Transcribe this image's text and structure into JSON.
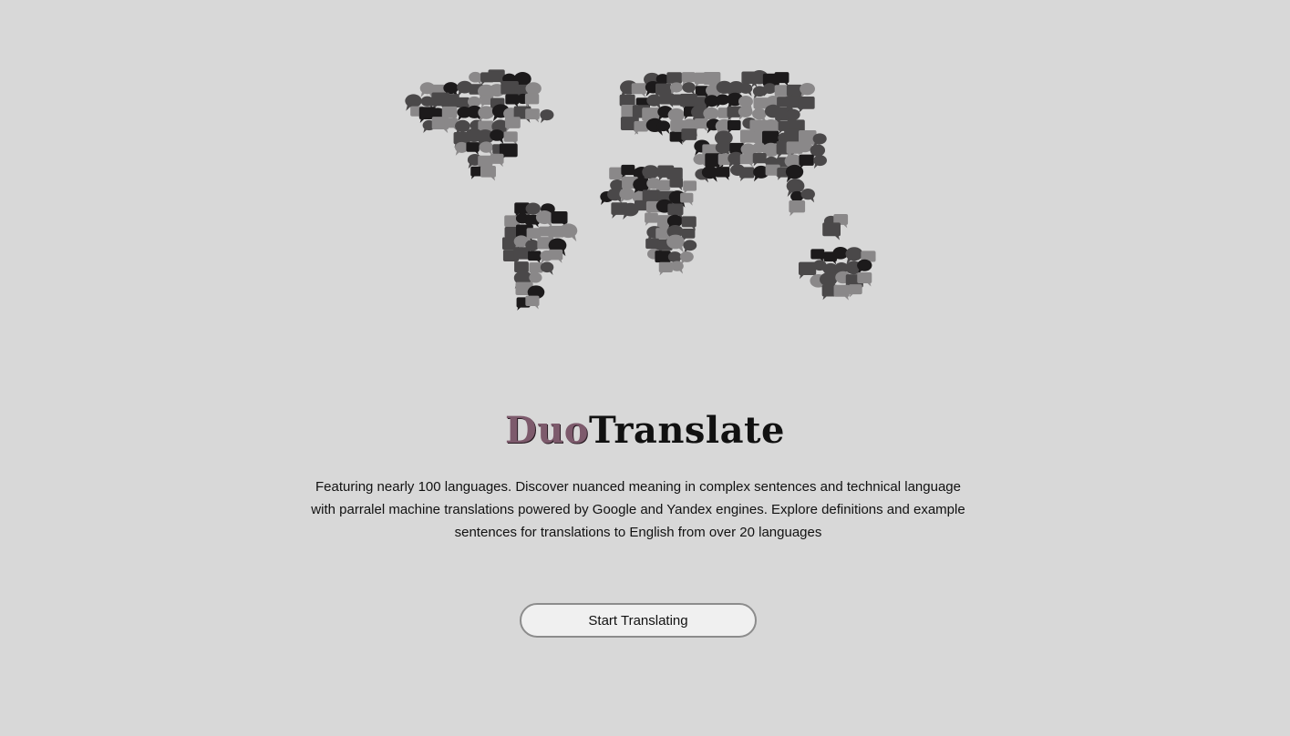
{
  "hero": {
    "map_icon": "world-map-speech-bubbles",
    "colors": {
      "background": "#d8d8d8",
      "bubble_dark": "#1c1a1b",
      "bubble_mid": "#4a4849",
      "bubble_light": "#8a8889"
    }
  },
  "brand": {
    "prefix": "Duo",
    "suffix": "Translate",
    "accent": "#7d5a6c"
  },
  "intro": {
    "text": "Featuring nearly 100 languages. Discover nuanced meaning in complex sentences and technical language with parralel machine translations powered by Google and Yandex engines. Explore definitions and example sentences for translations to English from over 20 languages"
  },
  "cta": {
    "label": "Start Translating"
  }
}
